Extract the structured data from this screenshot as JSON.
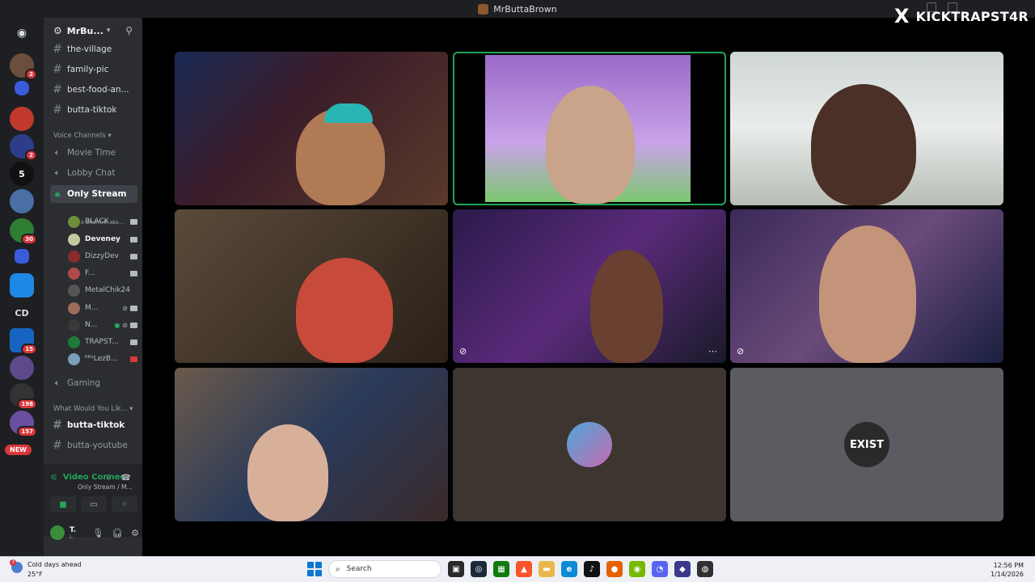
{
  "window": {
    "title": "MrButtaBrown"
  },
  "watermark": {
    "x_glyph": "X",
    "handle": "KICKTRAPST4R"
  },
  "rail": {
    "home_icon": "discord-icon",
    "items": [
      {
        "badge": "2"
      },
      {
        "badge": ""
      },
      {
        "badge": ""
      },
      {
        "badge": "2"
      },
      {
        "label": "5"
      },
      {
        "badge": ""
      },
      {
        "badge": "30"
      },
      {
        "badge": ""
      },
      {
        "badge": ""
      },
      {
        "label": "CD"
      },
      {
        "badge": "15"
      },
      {
        "badge": ""
      },
      {
        "badge": "198"
      },
      {
        "badge": "157"
      }
    ],
    "new_label": "NEW"
  },
  "sidebar": {
    "server_name": "MrBu...",
    "channels_top": [
      {
        "name": "the-village"
      },
      {
        "name": "family-pic"
      },
      {
        "name": "best-food-an..."
      },
      {
        "name": "butta-tiktok"
      }
    ],
    "voice_category": "Voice Channels",
    "voice_channels": [
      {
        "name": "Movie Time"
      },
      {
        "name": "Lobby Chat"
      },
      {
        "name": "Only Stream"
      }
    ],
    "channel_status_placeholder": "Set a channel sta...",
    "members": [
      {
        "name": "BLACK..."
      },
      {
        "name": "Deveney"
      },
      {
        "name": "DizzyDev"
      },
      {
        "name": "F..."
      },
      {
        "name": "MetalChik24"
      },
      {
        "name": "M..."
      },
      {
        "name": "N..."
      },
      {
        "name": "TRAPST..."
      },
      {
        "name": "ᴷᴷˢLezB..."
      }
    ],
    "gaming_channel": "Gaming",
    "category2": "What Would You Lik...",
    "channels_bottom": [
      {
        "name": "butta-tiktok"
      },
      {
        "name": "butta-youtube"
      }
    ]
  },
  "voice_panel": {
    "title": "Video Connec",
    "subtitle": "Only Stream / M..."
  },
  "user": {
    "name": "T.",
    "sub": "L."
  },
  "stage": {
    "tiles": [
      {
        "label": ""
      },
      {
        "label": ""
      },
      {
        "label": ""
      },
      {
        "label": ""
      },
      {
        "label": ""
      },
      {
        "label": ""
      },
      {
        "label": ""
      },
      {
        "label": ""
      },
      {
        "label": "EXIST"
      }
    ]
  },
  "taskbar": {
    "weather_title": "Cold days ahead",
    "weather_temp": "25°F",
    "weather_badge": "3",
    "search_placeholder": "Search",
    "time": "12:56 PM",
    "date": "1/14/2026"
  },
  "colors": {
    "accent_green": "#23a55a",
    "badge_red": "#da373c",
    "sidebar_bg": "#2b2d31",
    "rail_bg": "#1e1f22"
  }
}
